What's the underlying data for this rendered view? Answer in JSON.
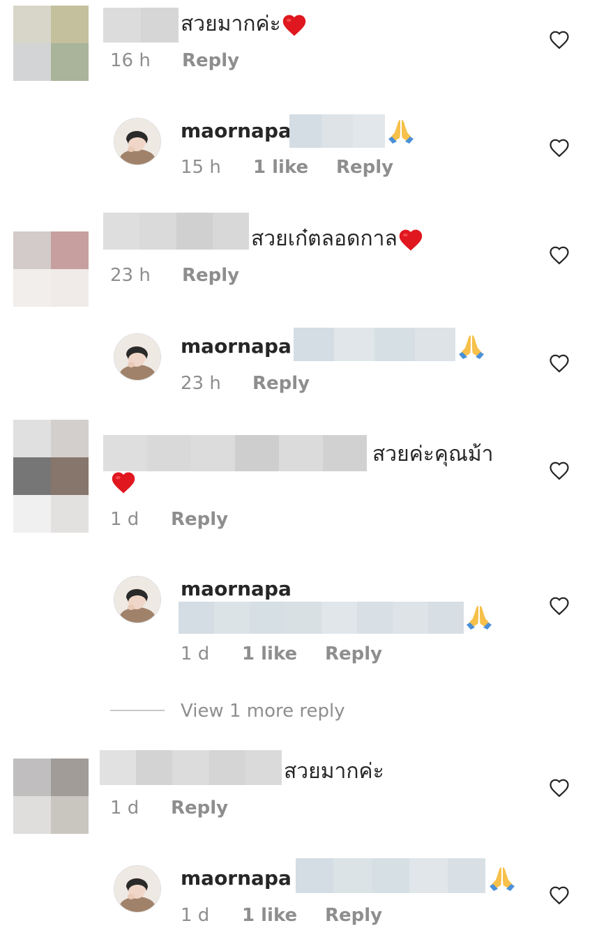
{
  "colors": {
    "text": "#262626",
    "muted": "#8e8e8e",
    "heart_emoji": "#e0171f",
    "pray_emoji": "#4a90d9"
  },
  "comments": [
    {
      "text": "สวยมากค่ะ",
      "emoji": "red-heart",
      "time": "16 h",
      "reply": "Reply",
      "replies": [
        {
          "username": "maornapa",
          "emoji": "folded-hands",
          "time": "15 h",
          "likes": "1 like",
          "reply": "Reply"
        }
      ]
    },
    {
      "text": "สวยเก๋ตลอดกาล",
      "emoji": "red-heart",
      "time": "23 h",
      "reply": "Reply",
      "replies": [
        {
          "username": "maornapa",
          "emoji": "folded-hands",
          "time": "23 h",
          "reply": "Reply"
        }
      ]
    },
    {
      "text": "สวยค่ะคุณม้า",
      "emoji": "red-heart",
      "time": "1 d",
      "reply": "Reply",
      "replies": [
        {
          "username": "maornapa",
          "emoji": "folded-hands",
          "time": "1 d",
          "likes": "1 like",
          "reply": "Reply"
        }
      ],
      "view_more": "View 1 more reply"
    },
    {
      "text": "สวยมากค่ะ",
      "time": "1 d",
      "reply": "Reply",
      "replies": [
        {
          "username": "maornapa",
          "emoji": "folded-hands",
          "time": "1 d",
          "likes": "1 like",
          "reply": "Reply"
        }
      ]
    }
  ]
}
